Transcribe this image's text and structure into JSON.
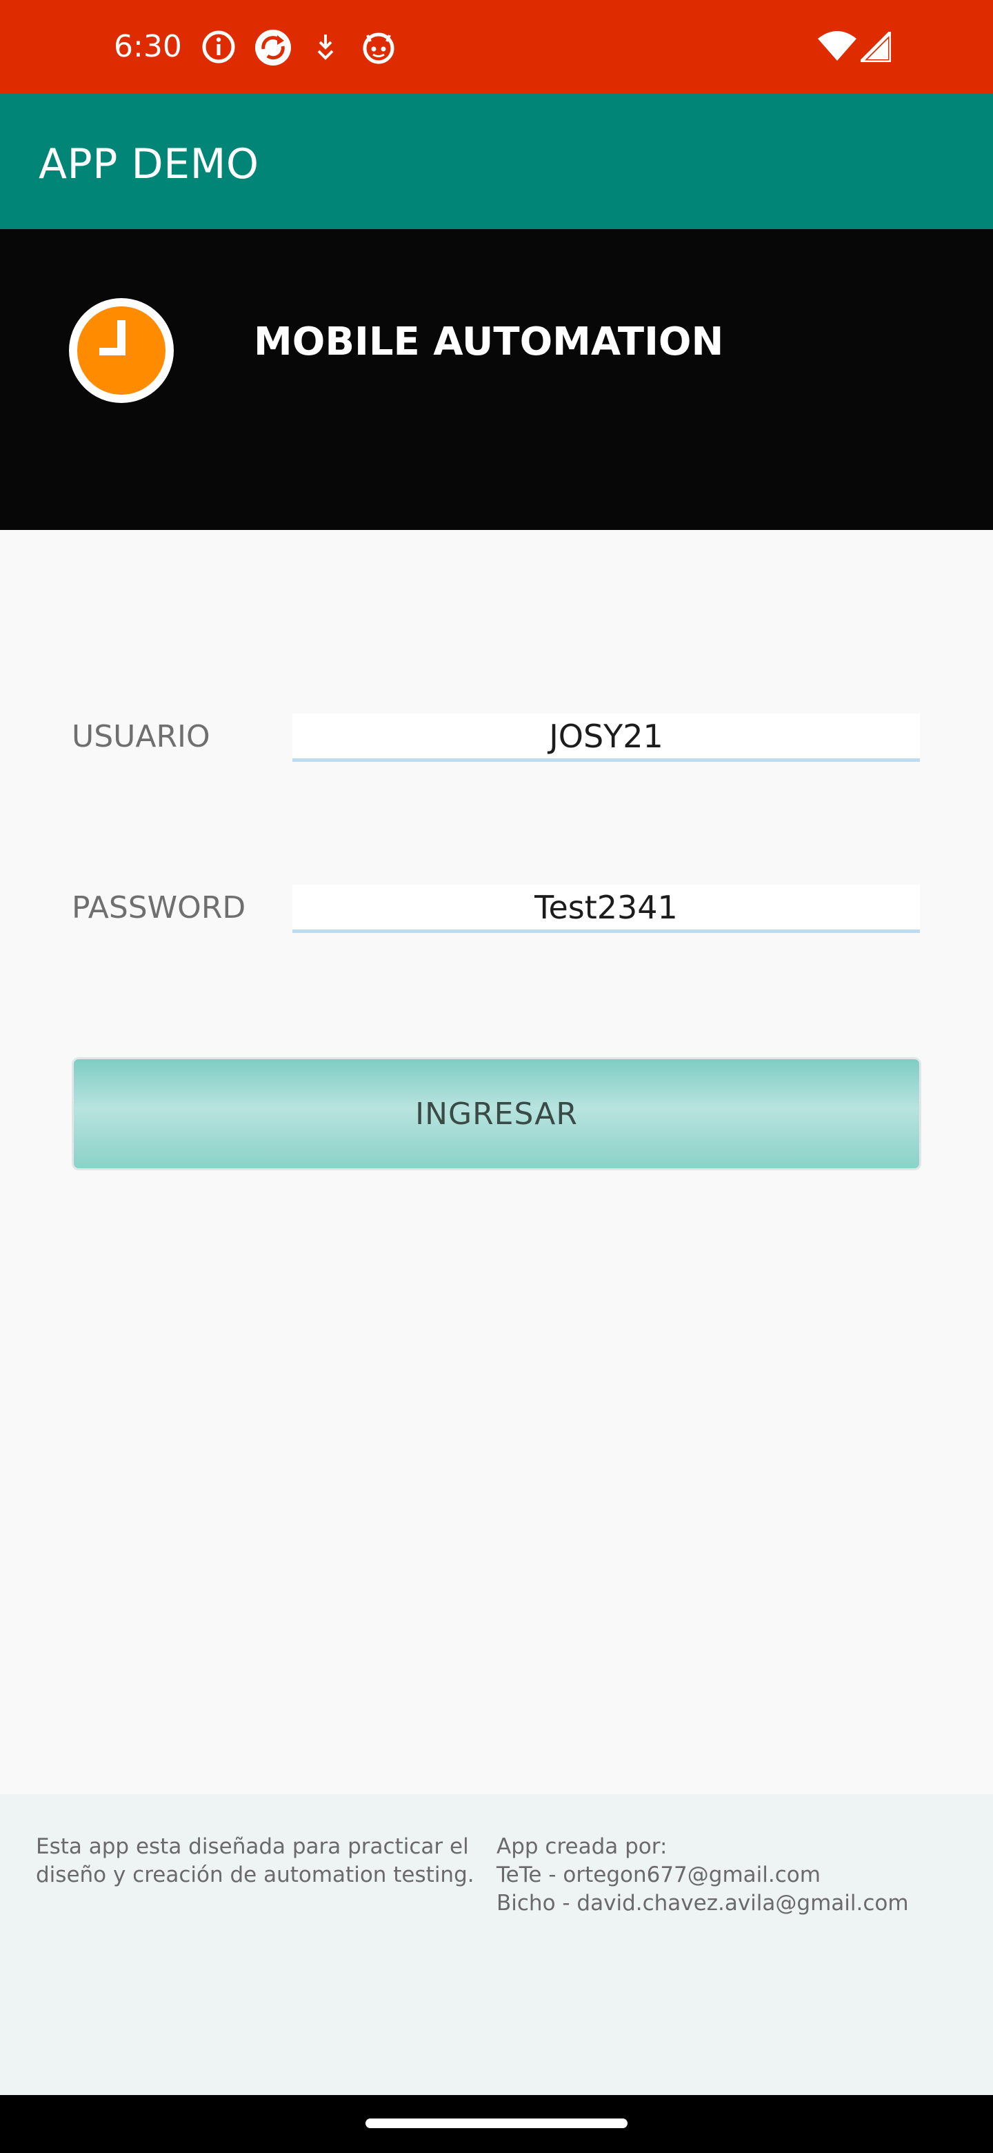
{
  "status_bar": {
    "time": "6:30",
    "icons_left": [
      "info-icon",
      "sync-icon",
      "download-icon",
      "android-face-icon"
    ],
    "icons_right": [
      "wifi-icon",
      "cell-signal-icon"
    ],
    "background": "#de2b00"
  },
  "app_bar": {
    "title": "APP DEMO",
    "background": "#008577"
  },
  "banner": {
    "logo_icon": "clock-logo-icon",
    "title": "MOBILE AUTOMATION",
    "background": "#070707",
    "logo_color": "#ff8c00"
  },
  "form": {
    "username_label": "USUARIO",
    "username_value": "JOSY21",
    "password_label": "PASSWORD",
    "password_value": "Test2341",
    "submit_label": "INGRESAR"
  },
  "footer": {
    "description_line1": "Esta app esta diseñada para practicar el",
    "description_line2": "diseño y creación de automation testing.",
    "credits_heading": "App creada por:",
    "credit_1": "TeTe - ortegon677@gmail.com",
    "credit_2": "Bicho - david.chavez.avila@gmail.com"
  }
}
